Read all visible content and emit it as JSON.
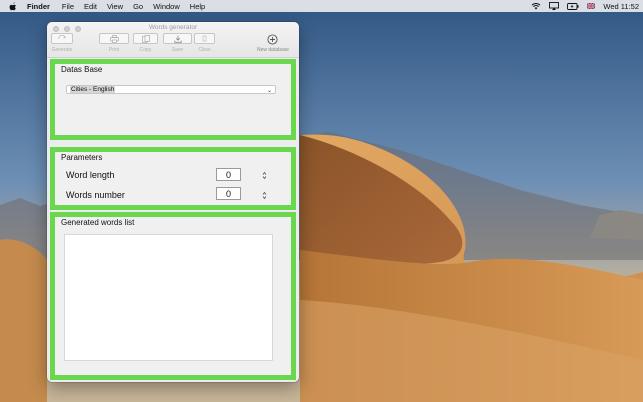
{
  "menubar": {
    "app_name": "Finder",
    "items": [
      "File",
      "Edit",
      "View",
      "Go",
      "Window",
      "Help"
    ],
    "clock": "Wed 11:52",
    "icons": [
      "apple-icon",
      "wifi-icon",
      "airplay-icon",
      "battery-icon",
      "flag-uk-icon"
    ]
  },
  "window": {
    "title": "Words generator",
    "toolbar": {
      "generate": "Generate",
      "print": "Print",
      "copy": "Copy",
      "save": "Save",
      "clear": "Clear",
      "new_database": "New database"
    }
  },
  "databse_panel": {
    "title": "Datas Base",
    "selected": "Cities - English"
  },
  "parameters": {
    "title": "Parameters",
    "word_length_label": "Word length",
    "word_length_value": "0",
    "words_number_label": "Words number",
    "words_number_value": "0"
  },
  "generated": {
    "title": "Generated words list"
  },
  "colors": {
    "panel_border": "#6ad84f",
    "window_bg": "#ececec"
  }
}
